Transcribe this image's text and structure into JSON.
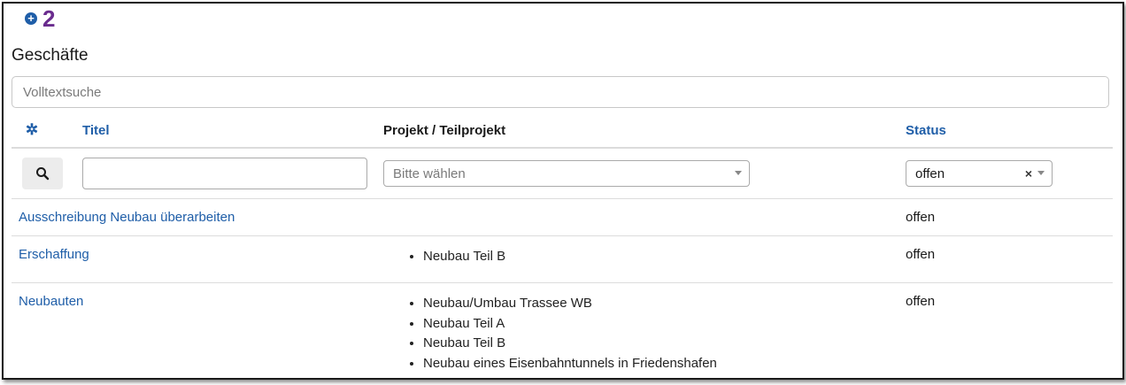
{
  "marker": {
    "number": "2",
    "icon": "plus-circle-icon"
  },
  "page_title": "Geschäfte",
  "search": {
    "placeholder": "Volltextsuche",
    "value": ""
  },
  "columns": {
    "title": "Titel",
    "project": "Projekt / Teilprojekt",
    "status": "Status"
  },
  "filters": {
    "title_value": "",
    "project_placeholder": "Bitte wählen",
    "status_value": "offen",
    "clear_symbol": "×"
  },
  "rows": [
    {
      "title": "Ausschreibung Neubau überarbeiten",
      "projects": [],
      "status": "offen"
    },
    {
      "title": "Erschaffung",
      "projects": [
        "Neubau Teil B"
      ],
      "status": "offen"
    },
    {
      "title": "Neubauten",
      "projects": [
        "Neubau/Umbau Trassee WB",
        "Neubau Teil A",
        "Neubau Teil B",
        "Neubau eines Eisenbahntunnels in Friedenshafen"
      ],
      "status": "offen"
    }
  ],
  "colors": {
    "link": "#1f5ea8",
    "marker": "#6a2c8e"
  }
}
